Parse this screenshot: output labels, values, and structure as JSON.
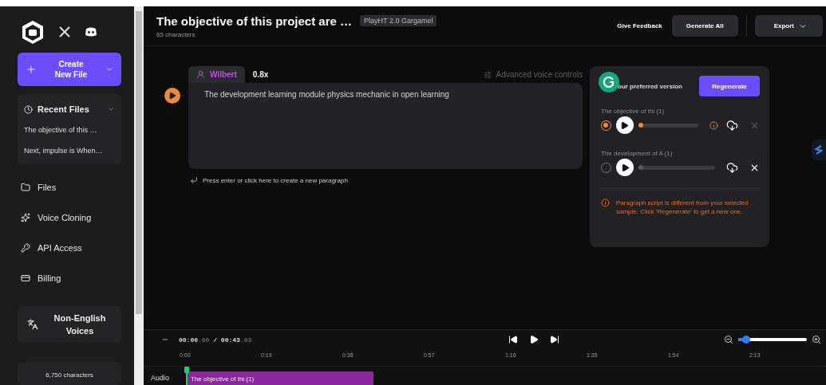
{
  "sidebar": {
    "create_button": {
      "label": "Create New File"
    },
    "recent": {
      "title": "Recent Files",
      "expanded": true,
      "items": [
        {
          "label": "The objective of this …"
        },
        {
          "label": "Next, impulse is When…"
        }
      ]
    },
    "nav": [
      {
        "label": "Files",
        "kind": "folder"
      },
      {
        "label": "Voice Cloning",
        "kind": "sparkle"
      },
      {
        "label": "API Access",
        "kind": "key"
      },
      {
        "label": "Billing",
        "kind": "card"
      }
    ],
    "languages": {
      "label": "Non-English Voices"
    },
    "usage": {
      "label": "6,750 characters"
    }
  },
  "header": {
    "title": "The objective of this project are …",
    "badge": "PlayHT 2.0 Gargamel",
    "subtitle": "65 characters",
    "feedback": "Give Feedback",
    "generate": "Generate All",
    "export": "Export"
  },
  "paragraph": {
    "voice": "Wilbert",
    "speed": "0.8x",
    "advanced": "Advanced voice controls",
    "text": "The development learning module physics mechanic in open learning",
    "hint": "Press enter or click here to create a new paragraph"
  },
  "versions": {
    "title": "our preferred version",
    "regenerate": "Regenerate",
    "samples": [
      {
        "name": "The objective of thi (1)",
        "selected": true,
        "level": 0.03,
        "mismatch": true
      },
      {
        "name": "The development of A (1)",
        "selected": false,
        "level": 0.0,
        "mismatch": false
      }
    ],
    "warning": "Paragraph script is different from your selected sample. Click 'Regenerate' to get a new one."
  },
  "timeline": {
    "current": "00:00",
    "current_fraction": ".00",
    "separator": "/",
    "total": "00:43",
    "total_fraction": ".03",
    "zoom": {
      "level": 0.12
    },
    "ticks": [
      "0:00",
      "0:19",
      "0:38",
      "0:57",
      "1:16",
      "1:35",
      "1:54",
      "2:13"
    ],
    "track": {
      "label": "Audio",
      "clip": "The objective of thi (1)"
    }
  }
}
